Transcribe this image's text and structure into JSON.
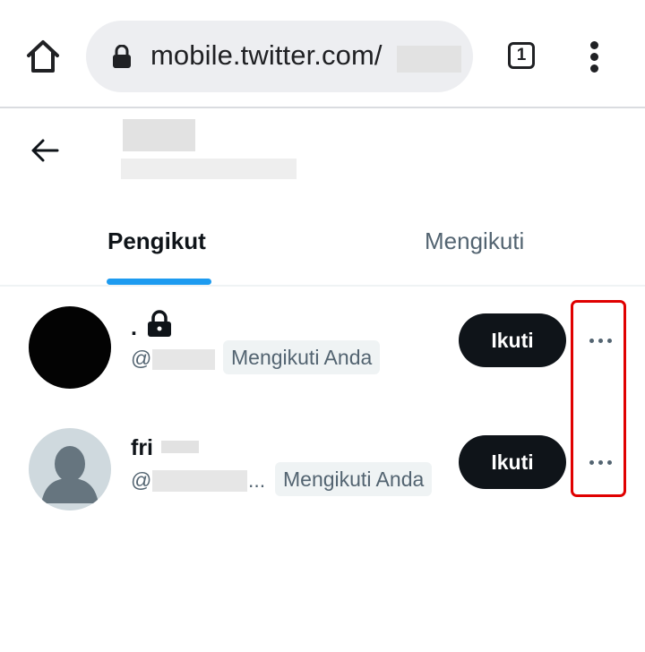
{
  "browser": {
    "url": "mobile.twitter.com/",
    "tab_count": "1",
    "icons": {
      "home": "home-icon",
      "lock": "lock-icon",
      "tabs": "tabs-icon",
      "menu": "more-vert-icon"
    }
  },
  "header": {
    "back_icon": "arrow-left-icon"
  },
  "tabs": [
    {
      "label": "Pengikut",
      "active": true
    },
    {
      "label": "Mengikuti",
      "active": false
    }
  ],
  "users": [
    {
      "name": ".",
      "protected": true,
      "handle_prefix": "@",
      "badge": "Mengikuti Anda",
      "follow_label": "Ikuti"
    },
    {
      "name": "fri",
      "protected": false,
      "handle_prefix": "@",
      "handle_suffix": "...",
      "badge": "Mengikuti Anda",
      "follow_label": "Ikuti"
    }
  ],
  "colors": {
    "accent": "#1d9bf0",
    "button": "#0f1419",
    "highlight": "#e00000",
    "secondary_text": "#536471"
  }
}
